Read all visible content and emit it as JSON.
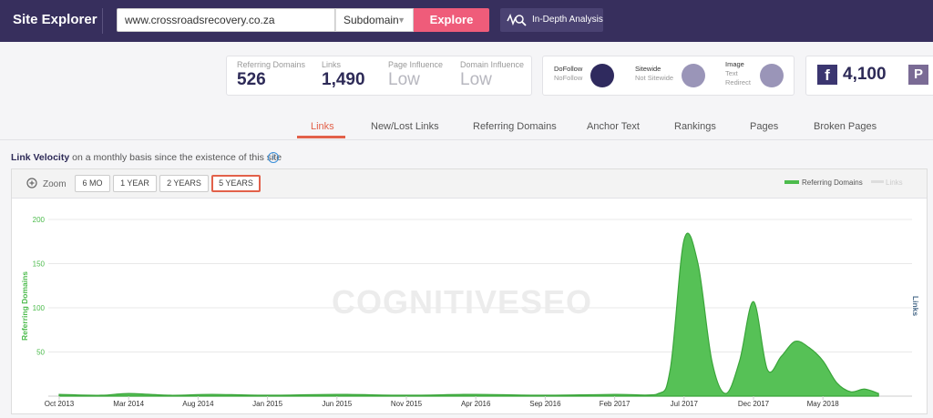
{
  "header": {
    "title": "Site Explorer",
    "url_value": "www.crossroadsrecovery.co.za",
    "subdomain": "Subdomain",
    "explore": "Explore",
    "in_depth": "In-Depth Analysis"
  },
  "metrics": {
    "referring_domains_label": "Referring Domains",
    "referring_domains_value": "526",
    "links_label": "Links",
    "links_value": "1,490",
    "page_influence_label": "Page Influence",
    "page_influence_value": "Low",
    "domain_influence_label": "Domain Influence",
    "domain_influence_value": "Low"
  },
  "follow": {
    "dofollow": "DoFollow",
    "nofollow": "NoFollow",
    "sitewide": "Sitewide",
    "not_sitewide": "Not Sitewide",
    "image": "Image",
    "text": "Text",
    "redirect": "Redirect"
  },
  "social": {
    "fb_icon": "f",
    "fb_count": "4,100",
    "pin_icon": "P"
  },
  "tabs": [
    "Links",
    "New/Lost Links",
    "Referring Domains",
    "Anchor Text",
    "Rankings",
    "Pages",
    "Broken Pages"
  ],
  "link_velocity": {
    "title": "Link Velocity",
    "subtitle": "on a monthly basis since the existence of this site",
    "info_icon": "i"
  },
  "zoom": {
    "label": "Zoom",
    "buttons": [
      "6 MO",
      "1 YEAR",
      "2 YEARS",
      "5 YEARS"
    ],
    "active": "5 YEARS"
  },
  "legend": {
    "referring_domains": "Referring Domains",
    "links": "Links"
  },
  "watermark": "COGNITIVESEO",
  "colors": {
    "header_bg": "#372f5d",
    "explore": "#ef5c7a",
    "accent": "#e2614a",
    "series": "#4cbb4c"
  },
  "chart_data": {
    "type": "area",
    "ylabel": "Referring Domains",
    "y2label": "Links",
    "ylim": [
      0,
      200
    ],
    "yticks": [
      50,
      100,
      150,
      200
    ],
    "xticks": [
      "Oct 2013",
      "Mar 2014",
      "Aug 2014",
      "Jan 2015",
      "Jun 2015",
      "Nov 2015",
      "Apr 2016",
      "Sep 2016",
      "Feb 2017",
      "Jul 2017",
      "Dec 2017",
      "May 2018"
    ],
    "series": [
      {
        "name": "Referring Domains",
        "x": [
          "2013-10",
          "2014-01",
          "2014-03",
          "2014-06",
          "2014-09",
          "2015-01",
          "2015-06",
          "2015-11",
          "2016-04",
          "2016-09",
          "2017-02",
          "2017-05",
          "2017-06",
          "2017-07",
          "2017-08",
          "2017-09",
          "2017-10",
          "2017-11",
          "2017-12",
          "2018-01",
          "2018-02",
          "2018-03",
          "2018-04",
          "2018-05",
          "2018-06",
          "2018-07",
          "2018-08",
          "2018-09"
        ],
        "values": [
          2,
          1,
          3,
          1,
          2,
          1,
          2,
          1,
          2,
          1,
          2,
          2,
          30,
          177,
          150,
          40,
          3,
          40,
          107,
          30,
          45,
          62,
          55,
          40,
          15,
          5,
          8,
          3
        ]
      }
    ]
  }
}
